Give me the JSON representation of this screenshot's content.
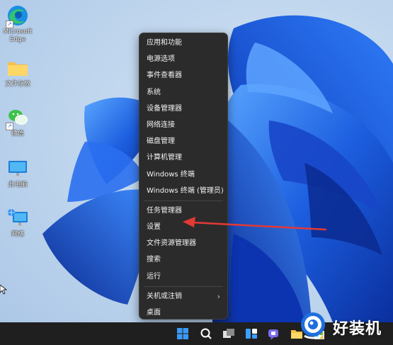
{
  "desktop": {
    "icons": [
      {
        "label": "Microsoft\nEdge",
        "icon": "edge-icon"
      },
      {
        "label": "文件存放",
        "icon": "folder-icon"
      },
      {
        "label": "微信",
        "icon": "wechat-icon"
      },
      {
        "label": "此电脑",
        "icon": "computer-icon"
      },
      {
        "label": "网络",
        "icon": "network-icon"
      }
    ]
  },
  "context_menu": {
    "group1": [
      "应用和功能",
      "电源选项",
      "事件查看器",
      "系统",
      "设备管理器",
      "网络连接",
      "磁盘管理",
      "计算机管理",
      "Windows 终端",
      "Windows 终端 (管理员)"
    ],
    "group2": [
      "任务管理器",
      "设置",
      "文件资源管理器",
      "搜索",
      "运行"
    ],
    "group3": [
      "关机或注销",
      "桌面"
    ],
    "submenu_arrow": "›"
  },
  "annotation": {
    "arrow_color": "#e53935",
    "points_to": "设置"
  },
  "taskbar": {
    "icons": [
      "start-icon",
      "search-icon",
      "task-view-icon",
      "widgets-icon",
      "chat-icon",
      "file-explorer-icon",
      "store-icon"
    ]
  },
  "watermark": {
    "text": "好装机"
  },
  "colors": {
    "menu_bg": "#2b2b2b",
    "menu_text": "#f2f2f2",
    "taskbar_bg": "#1f1f1f",
    "wallpaper_blue": "#1a56d8"
  }
}
